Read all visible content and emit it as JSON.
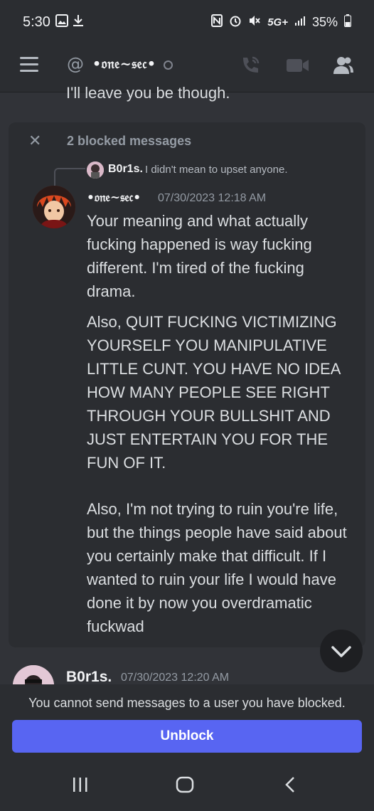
{
  "status_bar": {
    "time": "5:30",
    "network": "5G+",
    "battery": "35%"
  },
  "header": {
    "at_symbol": "@",
    "channel_name": "•𝔬𝔫𝔢~𝔰𝔢𝔠•"
  },
  "previous_message_tail": "I'll leave you be though.",
  "blocked_block": {
    "label": "2 blocked messages",
    "reply": {
      "author": "B0r1s.",
      "text": "I didn't mean to upset anyone."
    },
    "message": {
      "author": "•𝔬𝔫𝔢~𝔰𝔢𝔠•",
      "timestamp": "07/30/2023 12:18 AM",
      "paragraphs": [
        "Your meaning and what actually fucking happened is way fucking different. I'm tired of the fucking drama.",
        "Also, QUIT FUCKING VICTIMIZING YOURSELF YOU MANIPULATIVE LITTLE CUNT. YOU HAVE NO IDEA HOW MANY PEOPLE SEE RIGHT THROUGH YOUR BULLSHIT AND JUST ENTERTAIN YOU FOR THE FUN OF IT.",
        "Also, I'm not trying to ruin you're life, but the things people have said about you certainly make that difficult. If I wanted to ruin your life I would have done it by now you overdramatic fuckwad"
      ]
    }
  },
  "next_message": {
    "author": "B0r1s.",
    "timestamp": "07/30/2023 12:20 AM"
  },
  "footer": {
    "notice": "You cannot send messages to a user you have blocked.",
    "unblock_label": "Unblock"
  },
  "colors": {
    "background": "#313338",
    "panel": "#2b2d31",
    "accent": "#5865f2"
  }
}
